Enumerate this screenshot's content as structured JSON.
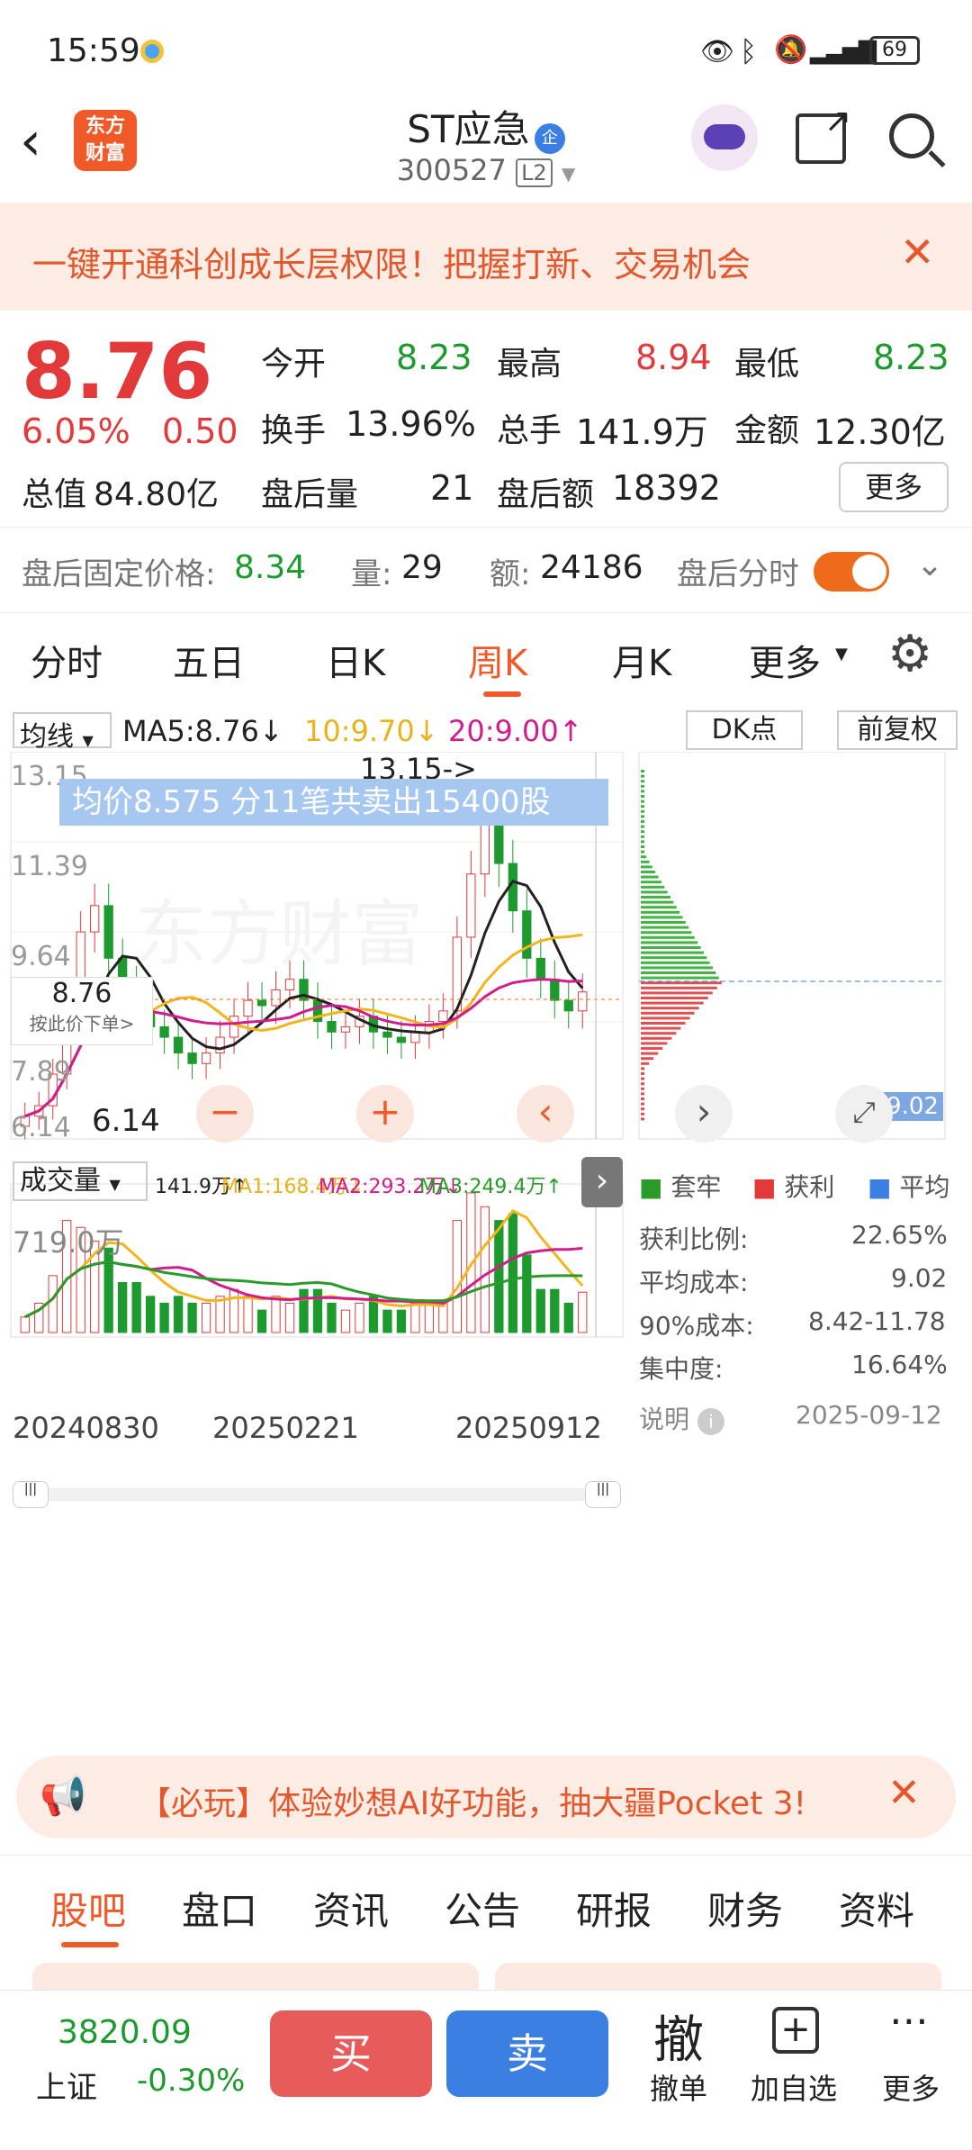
{
  "status": {
    "time": "15:59",
    "battery": "69"
  },
  "header": {
    "logo_line1": "东方",
    "logo_line2": "财富",
    "stock_name": "ST应急",
    "badge": "企",
    "code": "300527",
    "level": "L2"
  },
  "banner": {
    "text": "一键开通科创成长层权限！把握打新、交易机会"
  },
  "quote": {
    "price": "8.76",
    "pct": "6.05%",
    "change": "0.50",
    "market_cap_label": "总值",
    "market_cap": "84.80亿",
    "open_label": "今开",
    "open": "8.23",
    "high_label": "最高",
    "high": "8.94",
    "low_label": "最低",
    "low": "8.23",
    "turnover_label": "换手",
    "turnover": "13.96%",
    "volume_label": "总手",
    "volume": "141.9万",
    "amount_label": "金额",
    "amount": "12.30亿",
    "after_vol_label": "盘后量",
    "after_vol": "21",
    "after_amt_label": "盘后额",
    "after_amt": "18392",
    "more_label": "更多",
    "fixed_price_label": "盘后固定价格:",
    "fixed_price": "8.34",
    "fixed_vol_label": "量:",
    "fixed_vol": "29",
    "fixed_amt_label": "额:",
    "fixed_amt": "24186",
    "after_time_label": "盘后分时"
  },
  "tabs": [
    "分时",
    "五日",
    "日K",
    "周K",
    "月K",
    "更多"
  ],
  "active_tab": "周K",
  "chart": {
    "indicator_select": "均线",
    "ma5": "MA5:8.76↓",
    "ma10": "10:9.70↓",
    "ma20": "20:9.00↑",
    "dk_label": "DK点",
    "adjust_label": "前复权",
    "y_labels": [
      "13.15",
      "11.39",
      "9.64",
      "7.89",
      "6.14"
    ],
    "high_annotation": "13.15->",
    "low_annotation": "6.14",
    "tooltip_text": "均价8.575  分11笔共卖出15400股",
    "price_box_value": "8.76",
    "price_box_sub": "按此价下单>",
    "chip_price": "9.02",
    "volume_select": "成交量",
    "vol_value": "141.9万↑",
    "vol_ma1": "MA1:168.4万↓",
    "vol_ma2": "MA2:293.2万↓",
    "vol_ma3": "MA3:249.4万↑",
    "vol_max": "719.0万",
    "dates": [
      "20240830",
      "20250221",
      "20250912"
    ],
    "legend": [
      "套牢",
      "获利",
      "平均"
    ],
    "stats": [
      {
        "label": "获利比例:",
        "value": "22.65%"
      },
      {
        "label": "平均成本:",
        "value": "9.02"
      },
      {
        "label": "90%成本:",
        "value": "8.42-11.78"
      },
      {
        "label": "集中度:",
        "value": "16.64%"
      }
    ],
    "explain_label": "说明",
    "stat_date": "2025-09-12",
    "watermark": "东方财富"
  },
  "chart_data": {
    "type": "candlestick",
    "ylim": [
      6.14,
      13.15
    ],
    "weekly_close": [
      6.4,
      6.6,
      7.2,
      8.6,
      9.9,
      10.4,
      9.4,
      8.9,
      8.4,
      8.1,
      7.9,
      7.6,
      7.4,
      7.6,
      7.9,
      8.3,
      8.6,
      8.5,
      8.8,
      9.0,
      8.6,
      8.2,
      8.0,
      8.1,
      8.3,
      8.0,
      7.9,
      7.8,
      8.0,
      8.2,
      8.4,
      9.8,
      11.0,
      12.0,
      11.2,
      10.3,
      9.4,
      9.0,
      8.6,
      8.4,
      8.76
    ],
    "volume_scale_max": "719.0万"
  },
  "promo": {
    "text": "【必玩】体验妙想AI好功能，抽大疆Pocket 3!"
  },
  "bottom_tabs": [
    "股吧",
    "盘口",
    "资讯",
    "公告",
    "研报",
    "财务",
    "资料"
  ],
  "active_bottom_tab": "股吧",
  "bottom_bar": {
    "index_value": "3820.09",
    "index_name": "上证",
    "index_change": "-0.30%",
    "buy": "买",
    "sell": "卖",
    "cancel_big": "撤",
    "cancel_label": "撤单",
    "add_label": "加自选",
    "more_label": "更多"
  }
}
